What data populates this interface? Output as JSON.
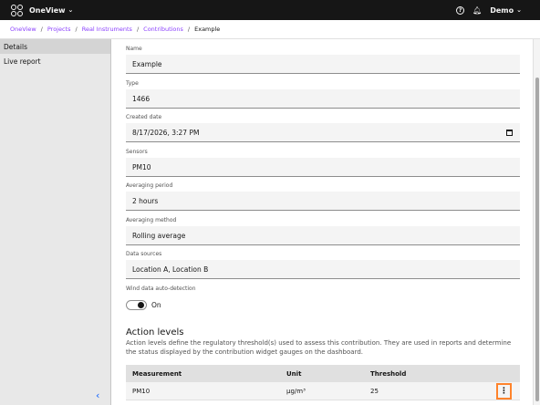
{
  "app": {
    "name": "OneView",
    "user": "Demo"
  },
  "breadcrumb": [
    {
      "label": "OneView"
    },
    {
      "label": "Projects"
    },
    {
      "label": "Real Instruments"
    },
    {
      "label": "Contributions"
    }
  ],
  "breadcrumb_current": "Example",
  "sidebar": {
    "items": [
      {
        "label": "Details"
      },
      {
        "label": "Live report"
      }
    ]
  },
  "form": {
    "name_label": "Name",
    "name_value": "Example",
    "type_label": "Type",
    "type_value": "1466",
    "created_label": "Created date",
    "created_value": "8/17/2026, 3:27 PM",
    "sensors_label": "Sensors",
    "sensors_value": "PM10",
    "period_label": "Averaging period",
    "period_value": "2 hours",
    "method_label": "Averaging method",
    "method_value": "Rolling average",
    "sources_label": "Data sources",
    "sources_value": "Location A, Location B",
    "wind_label": "Wind data auto-detection",
    "wind_state": "On"
  },
  "action_levels": {
    "title": "Action levels",
    "description": "Action levels define the regulatory threshold(s) used to assess this contribution. They are used in reports and determine the status displayed by the contribution widget gauges on the dashboard.",
    "columns": [
      "Measurement",
      "Unit",
      "Threshold"
    ],
    "rows": [
      {
        "measurement": "PM10",
        "unit": "µg/m³",
        "threshold": "25"
      }
    ]
  },
  "icons": {
    "overflow": "⋮",
    "collapse": "‹",
    "chevron": "⌄"
  },
  "colors": {
    "topbar": "#161616",
    "link": "#8a3ffc",
    "highlight": "#ff832b"
  }
}
